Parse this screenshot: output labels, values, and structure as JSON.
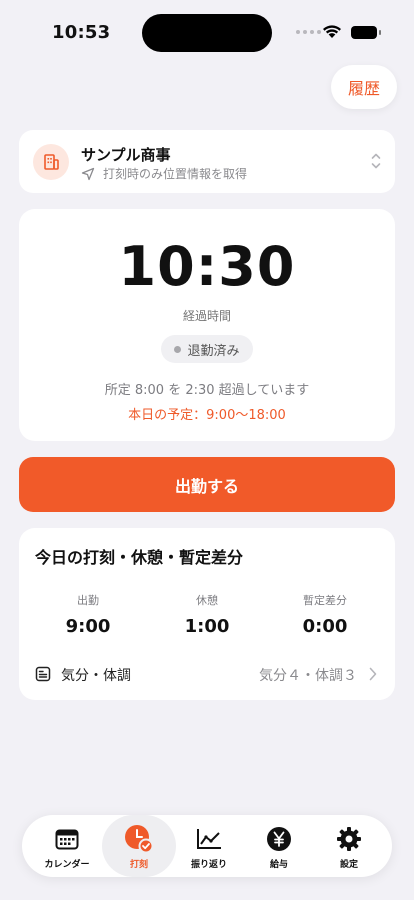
{
  "status_bar": {
    "time": "10:53"
  },
  "header": {
    "history_label": "履歴"
  },
  "company": {
    "name": "サンプル商事",
    "location_note": "打刻時のみ位置情報を取得"
  },
  "timer": {
    "elapsed": "10:30",
    "elapsed_label": "経過時間",
    "status": "退勤済み",
    "overtime_text": "所定 8:00 を 2:30 超過しています",
    "schedule_text": "本日の予定：9:00〜18:00"
  },
  "action": {
    "clock_in_label": "出勤する"
  },
  "summary": {
    "title": "今日の打刻・休憩・暫定差分",
    "stats": [
      {
        "label": "出勤",
        "value": "9:00"
      },
      {
        "label": "休憩",
        "value": "1:00"
      },
      {
        "label": "暫定差分",
        "value": "0:00"
      }
    ],
    "mood_label": "気分・体調",
    "mood_value": "気分４・体調３"
  },
  "tabs": [
    {
      "label": "カレンダー",
      "icon": "calendar-icon"
    },
    {
      "label": "打刻",
      "icon": "clock-check-icon",
      "active": true
    },
    {
      "label": "振り返り",
      "icon": "chart-icon"
    },
    {
      "label": "給与",
      "icon": "yen-icon"
    },
    {
      "label": "設定",
      "icon": "gear-icon"
    }
  ],
  "colors": {
    "accent": "#f15a29",
    "background": "#f2f1f6"
  }
}
